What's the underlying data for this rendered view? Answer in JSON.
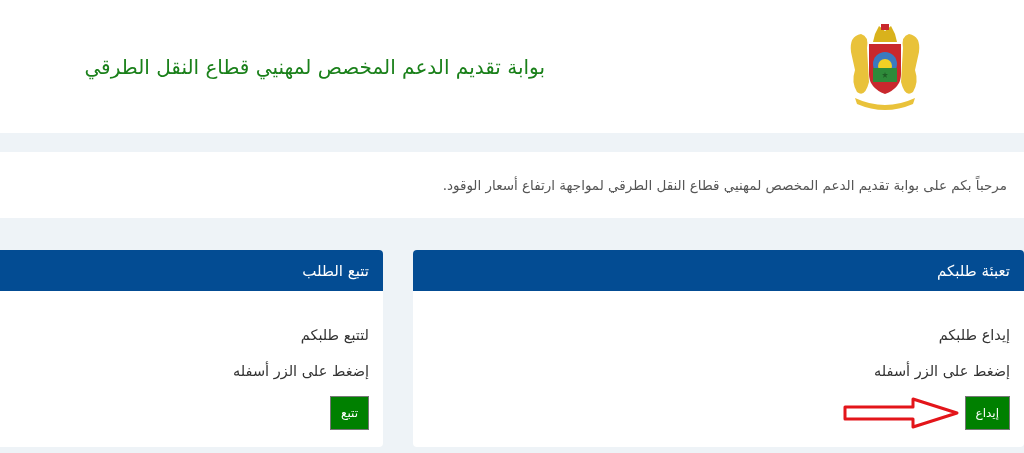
{
  "header": {
    "title": "بوابة تقديم الدعم المخصص لمهنيي قطاع النقل الطرقي"
  },
  "welcome": "مرحباً بكم على بوابة تقديم الدعم المخصص لمهنيي قطاع النقل الطرقي لمواجهة ارتفاع أسعار الوقود.",
  "cards": [
    {
      "title": "تعبئة طلبكم",
      "lines": [
        "إيداع طلبكم",
        "إضغط على الزر أسفله"
      ],
      "button": "إيداع",
      "annotated": true
    },
    {
      "title": "تتبع الطلب",
      "lines": [
        "لتتبع طلبكم",
        "إضغط على الزر أسفله"
      ],
      "button": "تتبع",
      "annotated": false
    }
  ]
}
